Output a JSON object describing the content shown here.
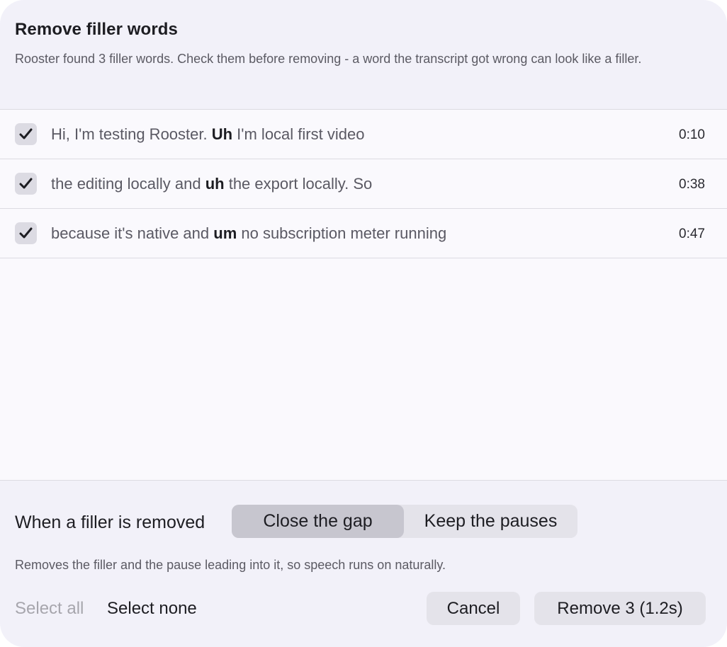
{
  "dialog": {
    "title": "Remove filler words",
    "subtitle": "Rooster found 3 filler words. Check them before removing - a word the transcript got wrong can look like a filler."
  },
  "fillers": [
    {
      "checked": true,
      "before": "Hi, I'm testing Rooster. ",
      "filler": "Uh",
      "after": " I'm local first video",
      "time": "0:10"
    },
    {
      "checked": true,
      "before": "the editing locally and ",
      "filler": "uh",
      "after": " the export locally. So",
      "time": "0:38"
    },
    {
      "checked": true,
      "before": "because it's native and ",
      "filler": "um",
      "after": " no subscription meter running",
      "time": "0:47"
    }
  ],
  "removal_mode": {
    "label": "When a filler is removed",
    "options": [
      "Close the gap",
      "Keep the pauses"
    ],
    "selected": "Close the gap",
    "description": "Removes the filler and the pause leading into it, so speech runs on naturally."
  },
  "actions": {
    "select_all": "Select all",
    "select_none": "Select none",
    "cancel": "Cancel",
    "remove": "Remove 3 (1.2s)"
  },
  "icons": {
    "checkbox": "checkmark-icon"
  }
}
